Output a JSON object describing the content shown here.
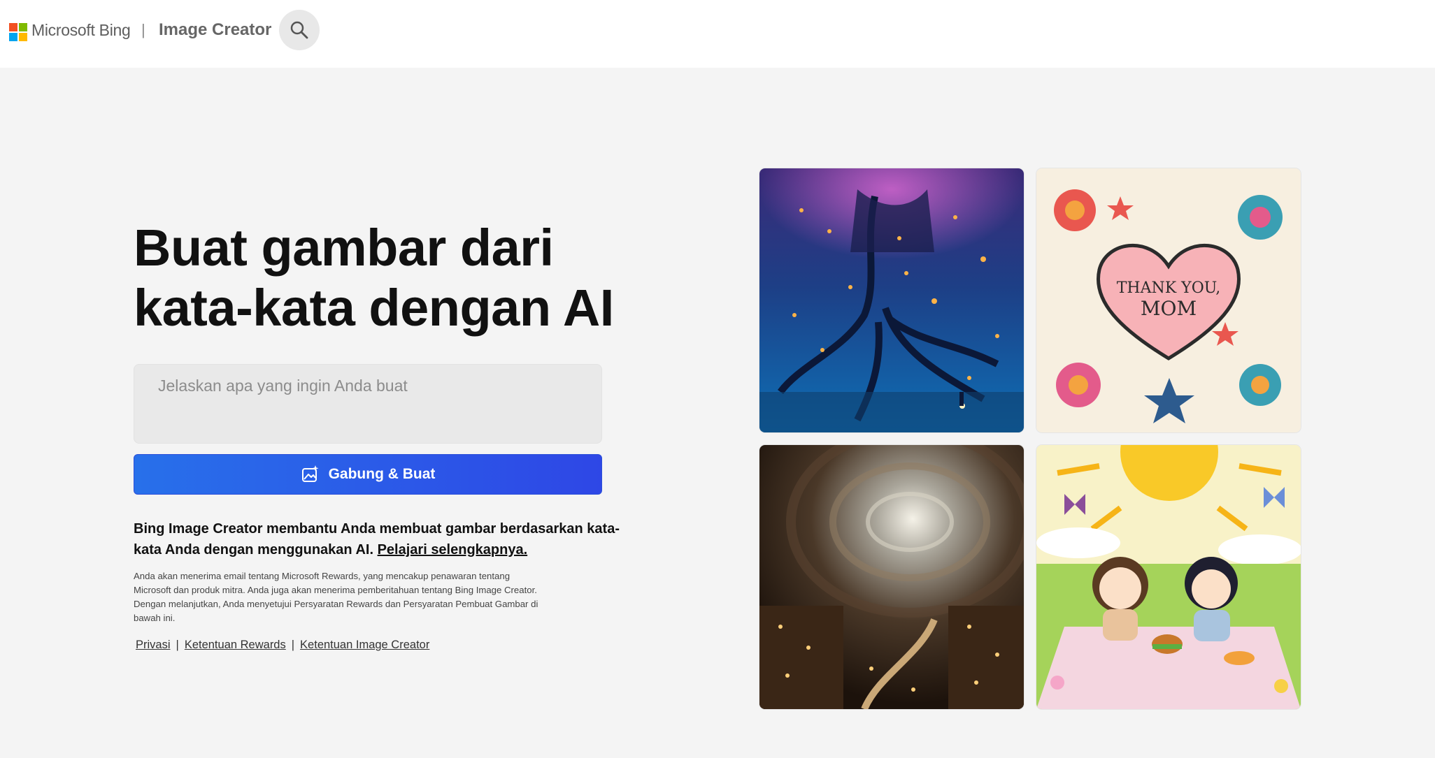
{
  "header": {
    "brand": "Microsoft Bing",
    "separator": "|",
    "app_title": "Image Creator",
    "search_icon": "search-icon",
    "logo_colors": [
      "#f25022",
      "#7fba00",
      "#00a4ef",
      "#ffb900"
    ]
  },
  "hero": {
    "title_line1": "Buat gambar dari",
    "title_line2": "kata-kata dengan AI"
  },
  "prompt": {
    "placeholder": "Jelaskan apa yang ingin Anda buat",
    "value": ""
  },
  "join_button": {
    "label": "Gabung & Buat",
    "icon": "image-sparkle-icon",
    "color": "#2b5ce8"
  },
  "description": {
    "text": "Bing Image Creator membantu Anda membuat gambar berdasarkan kata-kata Anda dengan menggunakan AI.",
    "link": "Pelajari selengkapnya."
  },
  "fine_print": "Anda akan menerima email tentang Microsoft Rewards, yang mencakup penawaran tentang Microsoft dan produk mitra. Anda juga akan menerima pemberitahuan tentang Bing Image Creator. Dengan melanjutkan, Anda menyetujui Persyaratan Rewards dan Persyaratan Pembuat Gambar di bawah ini.",
  "footer_links": {
    "privacy": "Privasi",
    "rewards_terms": "Ketentuan Rewards",
    "creator_terms": "Ketentuan Image Creator",
    "divider": "|"
  },
  "gallery": {
    "card_text_line1": "THANK YOU,",
    "card_text_line2": "MOM"
  }
}
